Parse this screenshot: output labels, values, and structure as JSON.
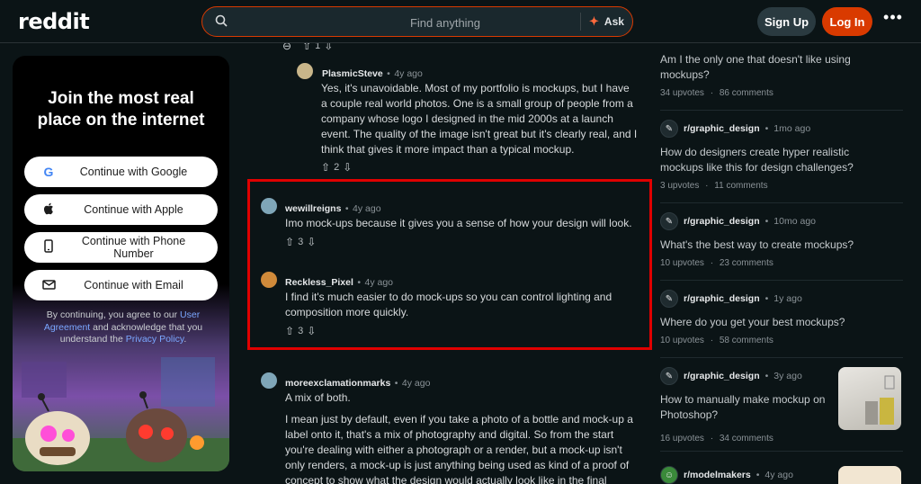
{
  "header": {
    "logo": "reddit",
    "search_placeholder": "Find anything",
    "ask_label": "Ask",
    "signup_label": "Sign Up",
    "login_label": "Log In"
  },
  "promo": {
    "title_line1": "Join the most real",
    "title_line2": "place on the internet",
    "google": "Continue with Google",
    "apple": "Continue with Apple",
    "phone": "Continue with Phone Number",
    "email": "Continue with Email",
    "legal_pre": "By continuing, you agree to our ",
    "legal_link1": "User Agreement",
    "legal_mid": " and acknowledge that you understand the ",
    "legal_link2": "Privacy Policy",
    "legal_post": "."
  },
  "comments": {
    "top_votes": "1",
    "c1": {
      "author": "PlasmicSteve",
      "time": "4y ago",
      "body": "Yes, it's unavoidable. Most of my portfolio is mockups, but I have a couple real world photos. One is a small group of people from a company whose logo I designed in the mid 2000s at a launch event. The quality of the image isn't great but it's clearly real, and I think that gives it more impact than a typical mockup.",
      "votes": "2"
    },
    "c2": {
      "author": "wewillreigns",
      "time": "4y ago",
      "body": "Imo mock-ups because it gives you a sense of how your design will look.",
      "votes": "3"
    },
    "c3": {
      "author": "Reckless_Pixel",
      "time": "4y ago",
      "body": "I find it's much easier to do mock-ups so you can control lighting and composition more quickly.",
      "votes": "3"
    },
    "c4": {
      "author": "moreexclamationmarks",
      "time": "4y ago",
      "body1": "A mix of both.",
      "body2": "I mean just by default, even if you take a photo of a bottle and mock-up a label onto it, that's a mix of photography and digital. So from the start you're dealing with either a photograph or a render, but a mock-up isn't only renders, a mock-up is just anything being used as kind of a proof of concept to show what the design would actually look like in the final"
    }
  },
  "sidebar": {
    "p0": {
      "title": "Am I the only one that doesn't like using mockups?",
      "upvotes": "34 upvotes",
      "comments": "86 comments"
    },
    "p1": {
      "sub": "r/graphic_design",
      "time": "1mo ago",
      "title": "How do designers create hyper realistic mockups like this for design challenges?",
      "upvotes": "3 upvotes",
      "comments": "11 comments"
    },
    "p2": {
      "sub": "r/graphic_design",
      "time": "10mo ago",
      "title": "What's the best way to create mockups?",
      "upvotes": "10 upvotes",
      "comments": "23 comments"
    },
    "p3": {
      "sub": "r/graphic_design",
      "time": "1y ago",
      "title": "Where do you get your best mockups?",
      "upvotes": "10 upvotes",
      "comments": "58 comments"
    },
    "p4": {
      "sub": "r/graphic_design",
      "time": "3y ago",
      "title": "How to manually make mockup on Photoshop?",
      "upvotes": "16 upvotes",
      "comments": "34 comments"
    },
    "p5": {
      "sub": "r/modelmakers",
      "time": "4y ago"
    },
    "dot": "·",
    "sep": "•"
  },
  "colors": {
    "background": "#0b1416",
    "accent": "#d93a00",
    "highlight": "#e00000",
    "link": "#7aa7ff"
  }
}
